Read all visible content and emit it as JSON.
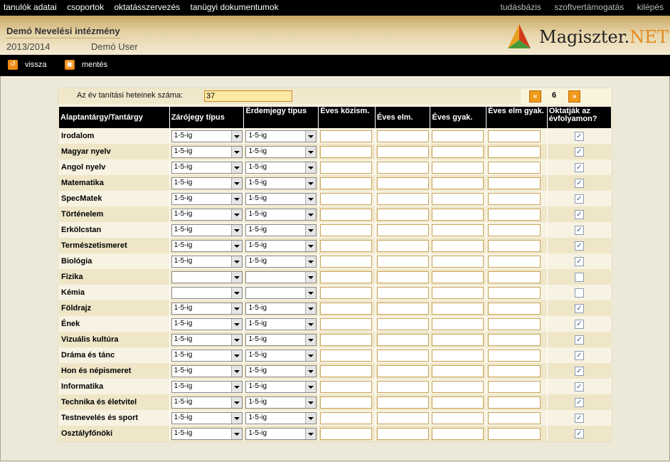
{
  "topnav": {
    "left": [
      "tanulók adatai",
      "csoportok",
      "oktatásszervezés",
      "tanügyi dokumentumok"
    ],
    "right": [
      "tudásbázis",
      "szoftvertámogatás",
      "kilépés"
    ]
  },
  "header": {
    "institution": "Demó Nevelési intézmény",
    "year": "2013/2014",
    "user": "Demó User",
    "logo_main": "Magiszter.",
    "logo_accent": "NET"
  },
  "toolbar": {
    "back_label": "vissza",
    "save_label": "mentés"
  },
  "weeks": {
    "label": "Az év tanítási heteinek száma:",
    "value": "37"
  },
  "pager": {
    "current": "6"
  },
  "table": {
    "headers": [
      "Alaptantárgy/Tantárgy",
      "Zárójegy típus",
      "Érdemjegy típus",
      "Éves közism.",
      "Éves elm.",
      "Éves gyak.",
      "Éves elm gyak.",
      "Oktatják az évfolyamon?"
    ],
    "rows": [
      {
        "name": "Irodalom",
        "zaro": "1-5-ig",
        "erdem": "1-5-ig",
        "checked": true
      },
      {
        "name": "Magyar nyelv",
        "zaro": "1-5-ig",
        "erdem": "1-5-ig",
        "checked": true
      },
      {
        "name": "Angol nyelv",
        "zaro": "1-5-ig",
        "erdem": "1-5-ig",
        "checked": true
      },
      {
        "name": "Matematika",
        "zaro": "1-5-ig",
        "erdem": "1-5-ig",
        "checked": true
      },
      {
        "name": "SpecMatek",
        "zaro": "1-5-ig",
        "erdem": "1-5-ig",
        "checked": true
      },
      {
        "name": "Történelem",
        "zaro": "1-5-ig",
        "erdem": "1-5-ig",
        "checked": true
      },
      {
        "name": "Erkölcstan",
        "zaro": "1-5-ig",
        "erdem": "1-5-ig",
        "checked": true
      },
      {
        "name": "Természetismeret",
        "zaro": "1-5-ig",
        "erdem": "1-5-ig",
        "checked": true
      },
      {
        "name": "Biológia",
        "zaro": "1-5-ig",
        "erdem": "1-5-ig",
        "checked": true
      },
      {
        "name": "Fizika",
        "zaro": "",
        "erdem": "",
        "checked": false
      },
      {
        "name": "Kémia",
        "zaro": "",
        "erdem": "",
        "checked": false
      },
      {
        "name": "Földrajz",
        "zaro": "1-5-ig",
        "erdem": "1-5-ig",
        "checked": true
      },
      {
        "name": "Ének",
        "zaro": "1-5-ig",
        "erdem": "1-5-ig",
        "checked": true
      },
      {
        "name": "Vizuális kultúra",
        "zaro": "1-5-ig",
        "erdem": "1-5-ig",
        "checked": true
      },
      {
        "name": "Dráma és tánc",
        "zaro": "1-5-ig",
        "erdem": "1-5-ig",
        "checked": true
      },
      {
        "name": "Hon és népismeret",
        "zaro": "1-5-ig",
        "erdem": "1-5-ig",
        "checked": true
      },
      {
        "name": "Informatika",
        "zaro": "1-5-ig",
        "erdem": "1-5-ig",
        "checked": true
      },
      {
        "name": "Technika és életvitel",
        "zaro": "1-5-ig",
        "erdem": "1-5-ig",
        "checked": true
      },
      {
        "name": "Testnevelés és sport",
        "zaro": "1-5-ig",
        "erdem": "1-5-ig",
        "checked": true
      },
      {
        "name": "Osztályfőnöki",
        "zaro": "1-5-ig",
        "erdem": "1-5-ig",
        "checked": true
      }
    ]
  },
  "icons": {
    "back": "undo-icon",
    "save": "save-icon",
    "prev": "double-chevron-left-icon",
    "next": "double-chevron-right-icon",
    "logo": "magiszter-logo-icon"
  },
  "colors": {
    "accent": "#f08a12",
    "header_top": "#c9a865",
    "row_light": "#f7f2e2",
    "row_dark": "#efe6c8"
  }
}
